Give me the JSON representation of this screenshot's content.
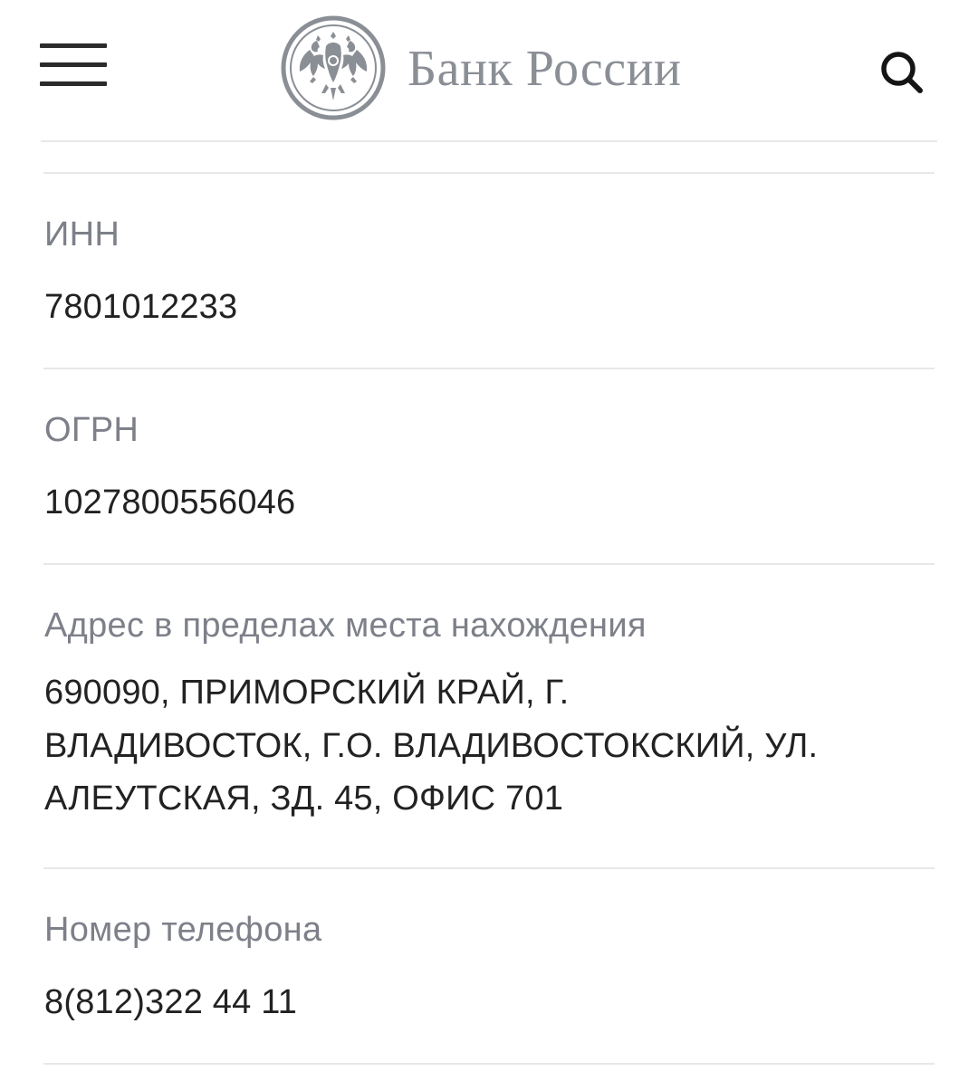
{
  "header": {
    "brand_name": "Банк России",
    "menu_icon": "hamburger-menu-icon",
    "emblem_icon": "double-headed-eagle-emblem",
    "search_icon": "search-icon"
  },
  "fields": {
    "inn": {
      "label": "ИНН",
      "value": "7801012233"
    },
    "ogrn": {
      "label": "ОГРН",
      "value": "1027800556046"
    },
    "address": {
      "label": "Адрес в пределах места нахождения",
      "line1": "690090, ПРИМОРСКИЙ КРАЙ, Г.",
      "line2": "ВЛАДИВОСТОК, Г.О. ВЛАДИВОСТОКСКИЙ, УЛ.",
      "line3": "АЛЕУТСКАЯ, ЗД. 45, ОФИС 701"
    },
    "phone": {
      "label": "Номер телефона",
      "value": "8(812)322 44 11"
    }
  },
  "colors": {
    "brand_gray": "#8a8e95",
    "label_gray": "#7d8089",
    "text_dark": "#222222",
    "divider": "#e7e8ea"
  }
}
